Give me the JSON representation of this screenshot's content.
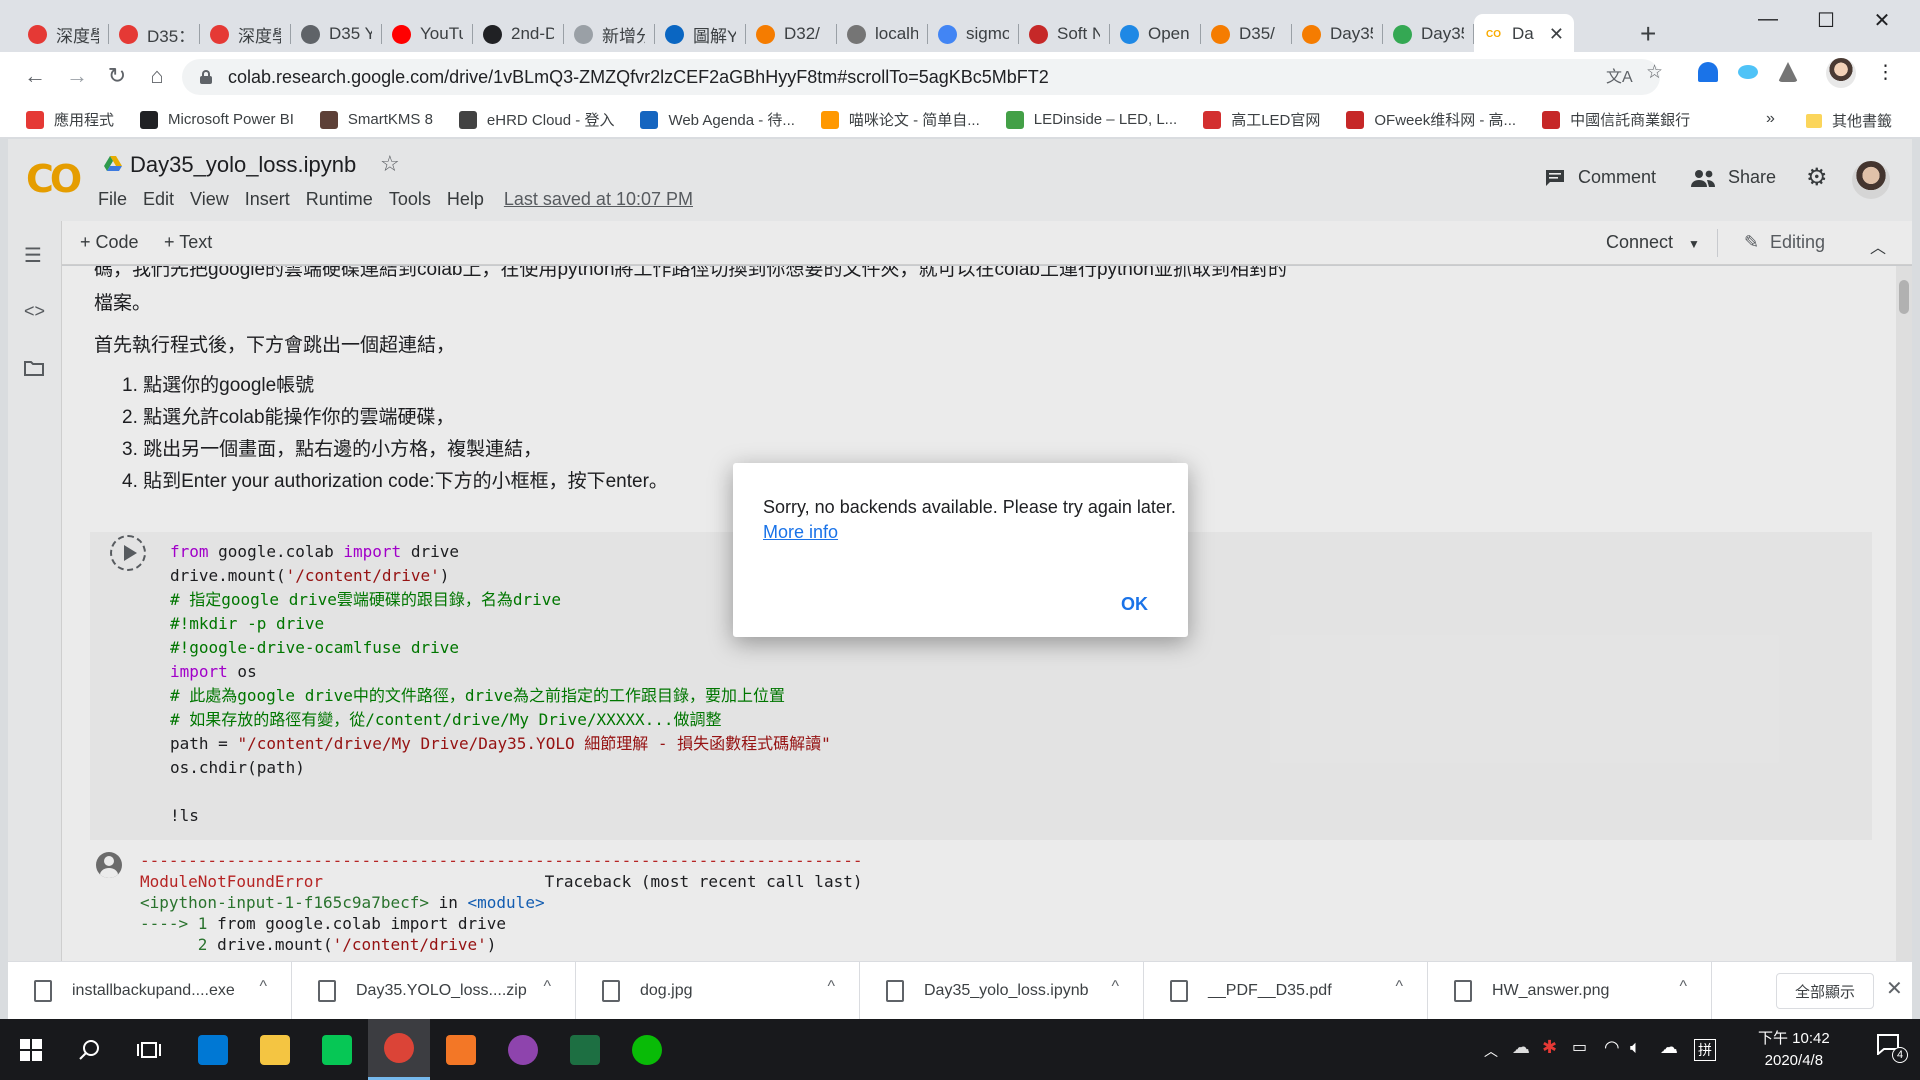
{
  "browser": {
    "tabs": [
      {
        "title": "深度學",
        "color": "#e53935"
      },
      {
        "title": "D35：",
        "color": "#e53935"
      },
      {
        "title": "深度學",
        "color": "#e53935"
      },
      {
        "title": "D35 Y",
        "color": "#5f6368"
      },
      {
        "title": "YouTu",
        "color": "#ff0000"
      },
      {
        "title": "2nd-D",
        "color": "#202124"
      },
      {
        "title": "新增分頁",
        "color": "#9aa0a6"
      },
      {
        "title": "圖解Y",
        "color": "#0a66c2"
      },
      {
        "title": "D32/",
        "color": "#f57c00"
      },
      {
        "title": "localh",
        "color": "#757575"
      },
      {
        "title": "sigmo",
        "color": "#4285f4"
      },
      {
        "title": "Soft N",
        "color": "#c62828"
      },
      {
        "title": "Open",
        "color": "#1e88e5"
      },
      {
        "title": "D35/",
        "color": "#f57c00"
      },
      {
        "title": "Day35",
        "color": "#f57c00"
      },
      {
        "title": "Day35",
        "color": "#34a853"
      }
    ],
    "active_tab": {
      "title": "Da",
      "close": "✕"
    },
    "new_tab": "+",
    "window_controls": {
      "minimize": "—",
      "maximize": "☐",
      "close": "✕"
    },
    "url": "colab.research.google.com/drive/1vBLmQ3-ZMZQfvr2lzCEF2aGBhHyyF8tm#scrollTo=5agKBc5MbFT2",
    "nav": {
      "back": "←",
      "forward": "→",
      "reload": "↻",
      "home": "⌂"
    },
    "star_icon": "☆",
    "menu_icon": "⋮"
  },
  "bookmarks": {
    "items": [
      {
        "label": "應用程式",
        "color": "#e53935"
      },
      {
        "label": "Microsoft Power BI",
        "color": "#202124"
      },
      {
        "label": "SmartKMS 8",
        "color": "#5d4037"
      },
      {
        "label": "eHRD Cloud - 登入",
        "color": "#424242"
      },
      {
        "label": "Web Agenda - 待...",
        "color": "#1565c0"
      },
      {
        "label": "喵咪论文 - 简单自...",
        "color": "#ff9800"
      },
      {
        "label": "LEDinside – LED, L...",
        "color": "#43a047"
      },
      {
        "label": "高工LED官网",
        "color": "#d32f2f"
      },
      {
        "label": "OFweek维科网 - 高...",
        "color": "#c62828"
      },
      {
        "label": "中國信託商業銀行",
        "color": "#c62828"
      }
    ],
    "more": "»",
    "other": "其他書籤"
  },
  "colab": {
    "logo": "CO",
    "title": "Day35_yolo_loss.ipynb",
    "menu": [
      "File",
      "Edit",
      "View",
      "Insert",
      "Runtime",
      "Tools",
      "Help"
    ],
    "last_saved": "Last saved at 10:07 PM",
    "comment": "Comment",
    "share": "Share",
    "toolbar": {
      "code": "+ Code",
      "text": "+ Text",
      "connect": "Connect",
      "editing": "Editing"
    }
  },
  "notebook": {
    "clipped_line": "碼，我們先把google的雲端硬碟連結到colab上，在使用python將工作路徑切換到你想要的文件夾，就可以在colab上運行python並抓取到相對的",
    "line2": "檔案。",
    "intro": "首先執行程式後，下方會跳出一個超連結，",
    "steps": [
      "1. 點選你的google帳號",
      "2. 點選允許colab能操作你的雲端硬碟，",
      "3. 跳出另一個畫面，點右邊的小方格，複製連結，",
      "4. 貼到Enter your authorization code:下方的小框框，按下enter。"
    ],
    "code": {
      "l1_kw1": "from",
      "l1_mod": " google.colab ",
      "l1_kw2": "import",
      "l1_rest": " drive",
      "l2_a": "drive.mount(",
      "l2_str": "'/content/drive'",
      "l2_b": ")",
      "l3": "# 指定google drive雲端硬碟的跟目錄，名為drive",
      "l4": "#!mkdir -p drive",
      "l5": "#!google-drive-ocamlfuse drive",
      "l6_kw": "import",
      "l6_rest": " os",
      "l7": "# 此處為google drive中的文件路徑，drive為之前指定的工作跟目錄，要加上位置",
      "l8": "# 如果存放的路徑有變，從/content/drive/My Drive/XXXXX...做調整",
      "l9_a": "path = ",
      "l9_str": "\"/content/drive/My Drive/Day35.YOLO 細節理解 - 損失函數程式碼解讀\"",
      "l10": "os.chdir(path)",
      "l11": "!ls"
    },
    "output": {
      "dashes": "---------------------------------------------------------------------------",
      "error": "ModuleNotFoundError",
      "traceback": "                       Traceback (most recent call last)",
      "input_ref": "<ipython-input-1-f165c9a7becf>",
      "in": " in ",
      "module": "<module>",
      "arrow": "----> 1 ",
      "line1": "from google.colab import drive",
      "line2_num": "      2 ",
      "line2_a": "drive.mount(",
      "line2_str": "'/content/drive'",
      "line2_b": ")"
    }
  },
  "dialog": {
    "message": "Sorry, no backends available. Please try again later.",
    "link": "More info",
    "ok": "OK"
  },
  "downloads": {
    "items": [
      "installbackupand....exe",
      "Day35.YOLO_loss....zip",
      "dog.jpg",
      "Day35_yolo_loss.ipynb",
      "__PDF__D35.pdf",
      "HW_answer.png"
    ],
    "show_all": "全部顯示",
    "caret": "^",
    "close": "✕"
  },
  "taskbar": {
    "apps": [
      {
        "name": "outlook",
        "color": "#0078d4"
      },
      {
        "name": "file-explorer",
        "color": "#f4c542"
      },
      {
        "name": "line",
        "color": "#06c755"
      },
      {
        "name": "chrome",
        "color": "#db4437"
      },
      {
        "name": "jupyter",
        "color": "#f37726"
      },
      {
        "name": "github-desktop",
        "color": "#8e44ad"
      },
      {
        "name": "excel",
        "color": "#1d6f42"
      },
      {
        "name": "wechat",
        "color": "#09bb07"
      }
    ],
    "time": "下午 10:42",
    "date": "2020/4/8",
    "notifications": "4"
  },
  "colors": {
    "accent": "#1a73e8",
    "colab_orange": "#f9ab00"
  }
}
